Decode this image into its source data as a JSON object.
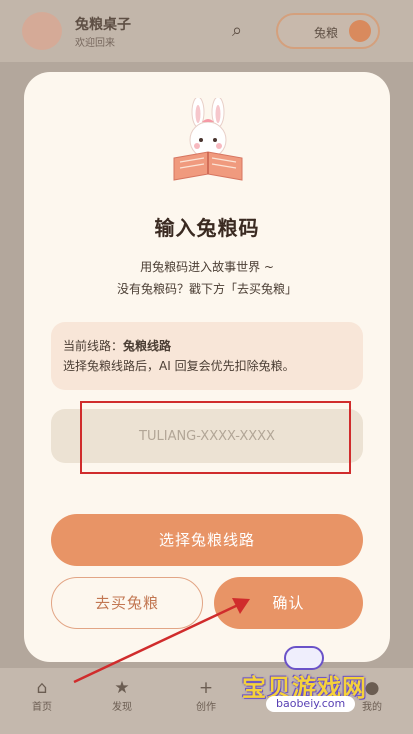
{
  "background": {
    "app_title": "兔粮桌子",
    "app_subtitle": "欢迎回来",
    "pill_label": "兔粮",
    "tabs": [
      "首页",
      "发现",
      "创作",
      "我的"
    ]
  },
  "dialog": {
    "title": "输入兔粮码",
    "desc_line1": "用兔粮码进入故事世界 ~",
    "desc_line2": "没有兔粮码？戳下方「去买兔粮」",
    "route_prefix": "当前线路：",
    "route_name": "兔粮线路",
    "route_note": "选择兔粮线路后，AI 回复会优先扣除兔粮。",
    "code_placeholder": "TULIANG-XXXX-XXXX",
    "code_value": "",
    "btn_route": "选择兔粮线路",
    "btn_buy": "去买兔粮",
    "btn_confirm": "确认"
  },
  "watermark": {
    "text": "宝贝游戏网",
    "url": "baobeiy.com"
  },
  "colors": {
    "accent": "#e89466",
    "dialog_bg": "#fdf7ee",
    "annotation": "#d02c2c"
  }
}
